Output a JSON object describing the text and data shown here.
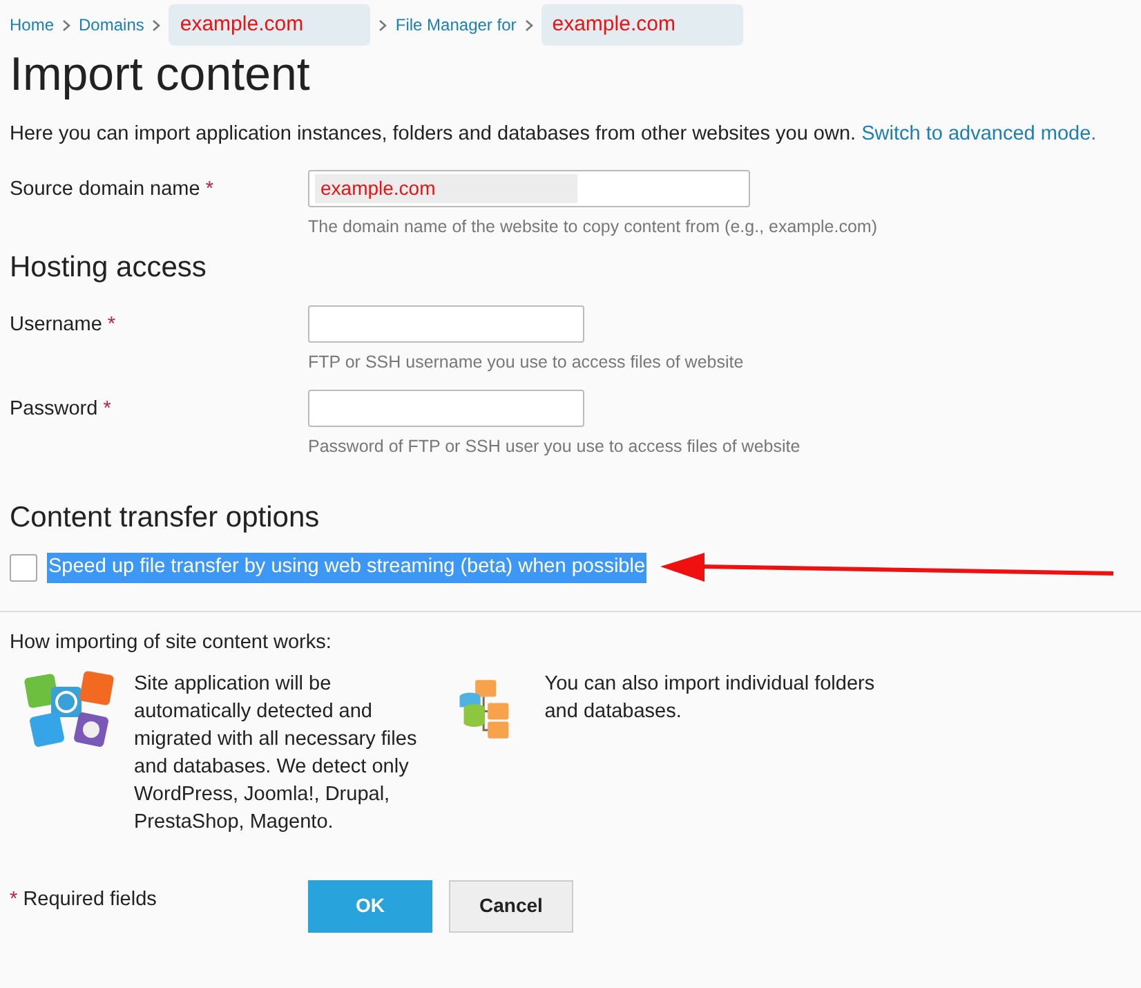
{
  "breadcrumbs": [
    {
      "text": "Home",
      "kind": "link"
    },
    {
      "text": "Domains",
      "kind": "link"
    },
    {
      "text": "example.com",
      "kind": "redacted"
    },
    {
      "text": "File Manager for",
      "kind": "link"
    },
    {
      "text": "example.com",
      "kind": "redacted"
    }
  ],
  "title": "Import content",
  "intro": "Here you can import application instances, folders and databases from other websites you own.",
  "intro_link": "Switch to advanced mode.",
  "source": {
    "label": "Source domain name",
    "required_mark": "*",
    "value": "example.com",
    "hint": "The domain name of the website to copy content from (e.g., example.com)"
  },
  "hosting_heading": "Hosting access",
  "fields": [
    {
      "label": "Username",
      "required_mark": "*",
      "hint": "FTP or SSH username you use to access files of website"
    },
    {
      "label": "Password",
      "required_mark": "*",
      "hint": "Password of FTP or SSH user you use to access files of website"
    }
  ],
  "transfer_heading": "Content transfer options",
  "option": {
    "label": "Speed up file transfer by using web streaming (beta) when possible",
    "checked": false,
    "highlighted": true
  },
  "how_heading": "How importing of site content works:",
  "how_items": [
    {
      "kind": "apps",
      "text": "Site application will be automatically detected and migrated with all necessary files and databases. We detect only WordPress, Joomla!, Drupal, PrestaShop, Magento."
    },
    {
      "kind": "folders",
      "text": "You can also import individual folders and databases."
    }
  ],
  "required_note": {
    "mark": "*",
    "text": "Required fields"
  },
  "buttons": [
    {
      "label": "OK",
      "kind": "primary"
    },
    {
      "label": "Cancel",
      "kind": "secondary"
    }
  ]
}
